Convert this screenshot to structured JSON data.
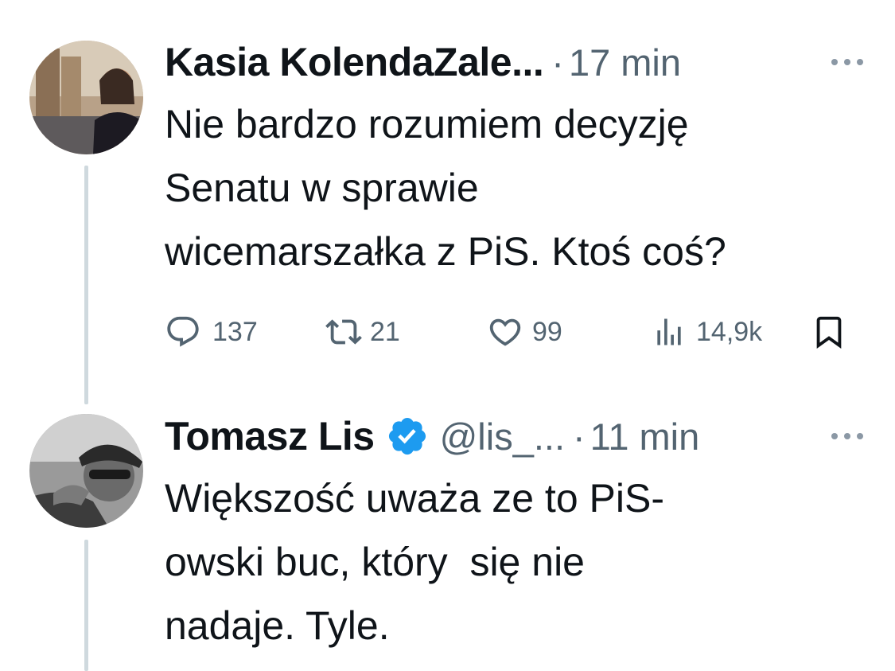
{
  "tweets": [
    {
      "author_name": "Kasia KolendaZale...",
      "handle": "",
      "time": "17 min",
      "verified": false,
      "text_lines": [
        "Nie bardzo rozumiem decyzję",
        "Senatu w sprawie",
        "wicemarszałka z PiS. Ktoś coś?"
      ],
      "actions": {
        "replies": "137",
        "reposts": "21",
        "likes": "99",
        "views": "14,9k"
      }
    },
    {
      "author_name": "Tomasz Lis",
      "handle": "@lis_...",
      "time": "11 min",
      "verified": true,
      "text_lines": [
        "Większość uważa ze to PiS-",
        "owski buc, który  się nie",
        "nadaje. Tyle."
      ]
    }
  ],
  "separator": "·",
  "icons": {
    "reply": "reply-icon",
    "repost": "repost-icon",
    "like": "like-icon",
    "views": "views-icon",
    "bookmark": "bookmark-icon",
    "more": "more-icon",
    "verified": "verified-badge-icon"
  },
  "colors": {
    "text": "#0f1419",
    "secondary": "#536471",
    "verified": "#1d9bf0",
    "thread_line": "#cfd9de"
  }
}
